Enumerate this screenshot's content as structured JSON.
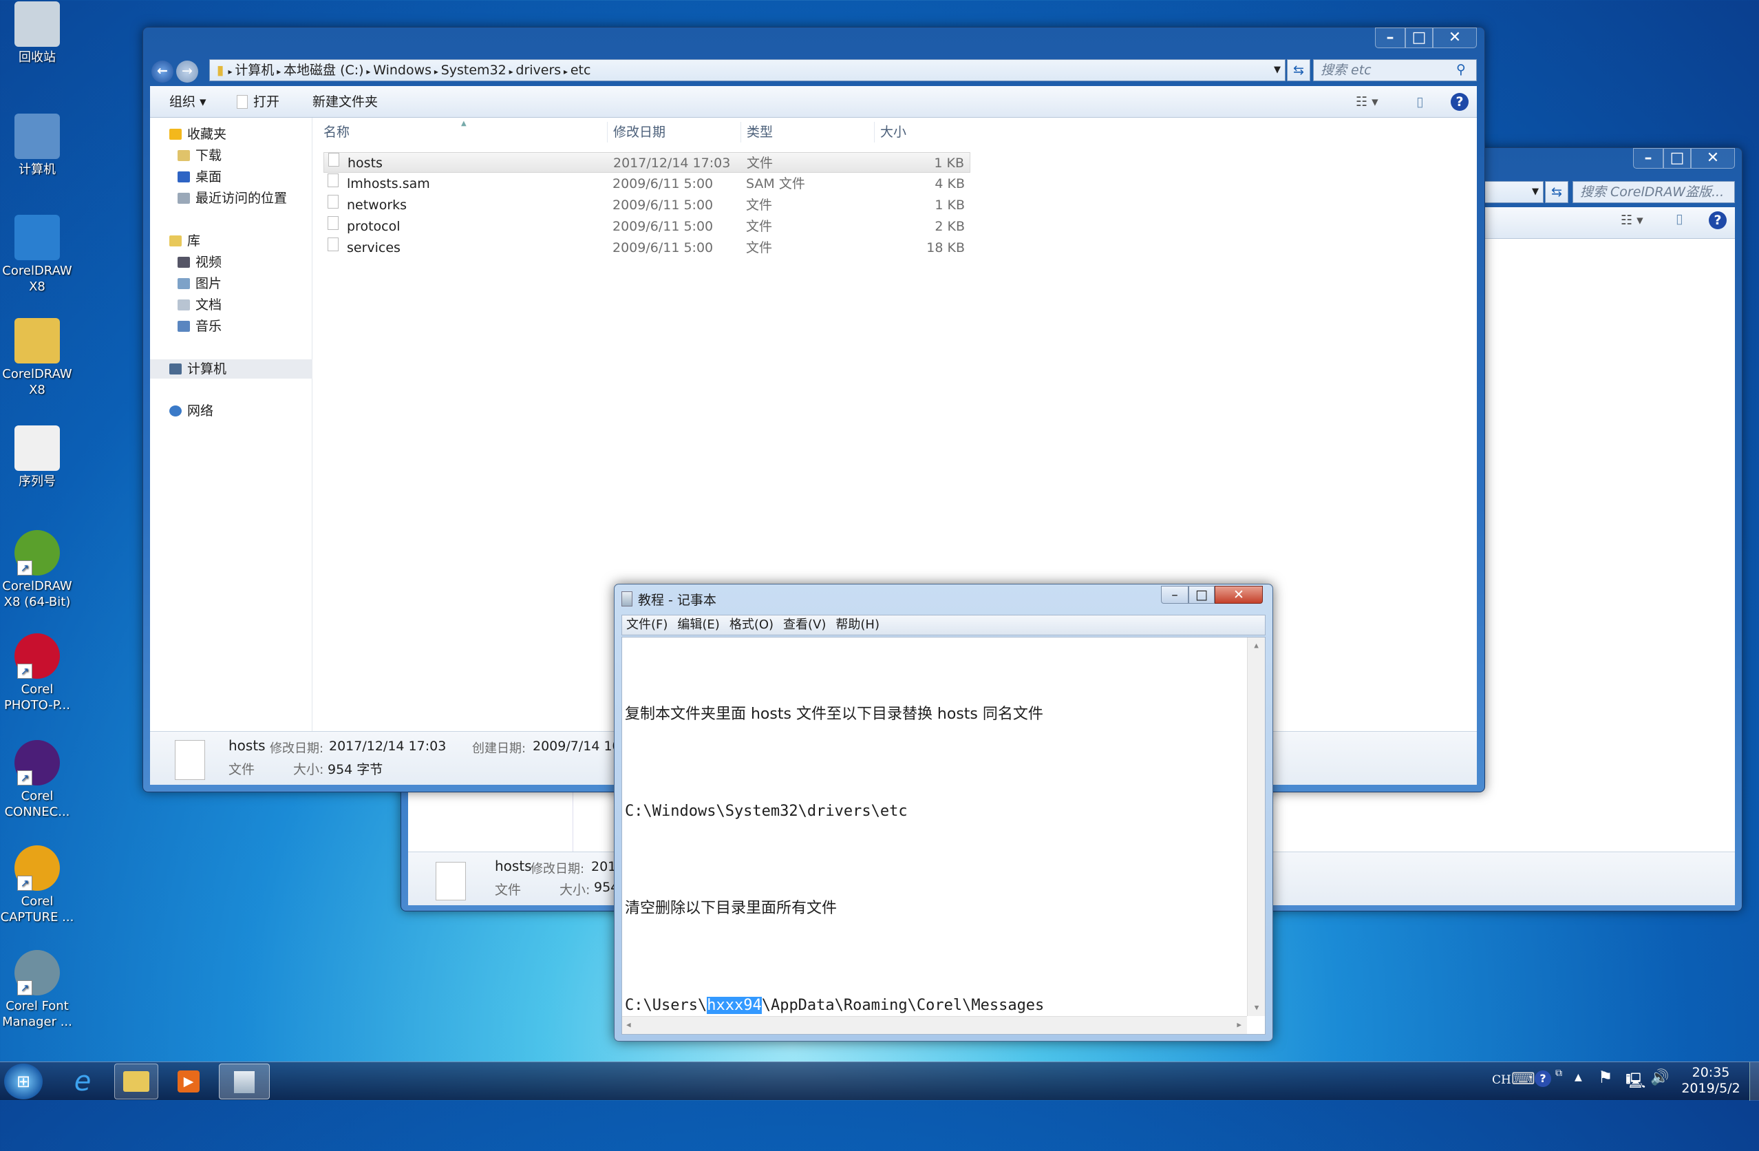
{
  "desktop": {
    "icons": [
      {
        "label": "回收站",
        "icon": "recycle-bin-icon"
      },
      {
        "label": "计算机",
        "icon": "computer-icon"
      },
      {
        "label": "CorelDRAW X8",
        "icon": "winrar-archive-icon"
      },
      {
        "label": "CorelDRAW X8",
        "icon": "folder-icon"
      },
      {
        "label": "序列号",
        "icon": "text-document-icon"
      },
      {
        "label": "CorelDRAW X8 (64-Bit)",
        "icon": "coreldraw-icon",
        "color": "#5aa02c"
      },
      {
        "label": "Corel PHOTO-P...",
        "icon": "corel-photo-paint-icon",
        "color": "#c8102e"
      },
      {
        "label": "Corel CONNEC...",
        "icon": "corel-connect-icon",
        "color": "#4b1e78"
      },
      {
        "label": "Corel CAPTURE ...",
        "icon": "corel-capture-icon",
        "color": "#e8a317"
      },
      {
        "label": "Corel Font Manager ...",
        "icon": "corel-font-manager-icon",
        "color": "#6d8fa0"
      }
    ]
  },
  "explorer": {
    "breadcrumb": [
      "计算机",
      "本地磁盘 (C:)",
      "Windows",
      "System32",
      "drivers",
      "etc"
    ],
    "search_placeholder": "搜索 etc",
    "toolbar": {
      "organize": "组织",
      "open": "打开",
      "new_folder": "新建文件夹"
    },
    "nav": {
      "favorites": "收藏夹",
      "downloads": "下载",
      "desktop": "桌面",
      "recent": "最近访问的位置",
      "libraries": "库",
      "videos": "视频",
      "pictures": "图片",
      "documents": "文档",
      "music": "音乐",
      "computer": "计算机",
      "network": "网络"
    },
    "columns": {
      "name": "名称",
      "date": "修改日期",
      "type": "类型",
      "size": "大小"
    },
    "files": [
      {
        "name": "hosts",
        "date": "2017/12/14 17:03",
        "type": "文件",
        "size": "1 KB",
        "selected": true
      },
      {
        "name": "lmhosts.sam",
        "date": "2009/6/11 5:00",
        "type": "SAM 文件",
        "size": "4 KB"
      },
      {
        "name": "networks",
        "date": "2009/6/11 5:00",
        "type": "文件",
        "size": "1 KB"
      },
      {
        "name": "protocol",
        "date": "2009/6/11 5:00",
        "type": "文件",
        "size": "2 KB"
      },
      {
        "name": "services",
        "date": "2009/6/11 5:00",
        "type": "文件",
        "size": "18 KB"
      }
    ],
    "details": {
      "name": "hosts",
      "modified_label": "修改日期:",
      "modified": "2017/12/14 17:03",
      "created_label": "创建日期:",
      "created": "2009/7/14 10:",
      "type": "文件",
      "size_label": "大小:",
      "size": "954 字节"
    }
  },
  "explorer_bg": {
    "search_placeholder": "搜索 CorelDRAW盗版...",
    "details": {
      "name": "hosts",
      "modified_label": "修改日期:",
      "modified": "2017",
      "type": "文件",
      "size_label": "大小:",
      "size": "954"
    }
  },
  "notepad": {
    "title": "教程 - 记事本",
    "menu": [
      "文件(F)",
      "编辑(E)",
      "格式(O)",
      "查看(V)",
      "帮助(H)"
    ],
    "lines": {
      "l1": "复制本文件夹里面 hosts 文件至以下目录替换 hosts 同名文件",
      "l2": "C:\\Windows\\System32\\drivers\\etc",
      "l3": "清空删除以下目录里面所有文件",
      "l4_pre": "C:\\Users\\",
      "l4_sel": "hxxx94",
      "l4_post": "\\AppData\\Roaming\\Corel\\Messages"
    }
  },
  "taskbar": {
    "lang": "CH",
    "time": "20:35",
    "date": "2019/5/2"
  }
}
